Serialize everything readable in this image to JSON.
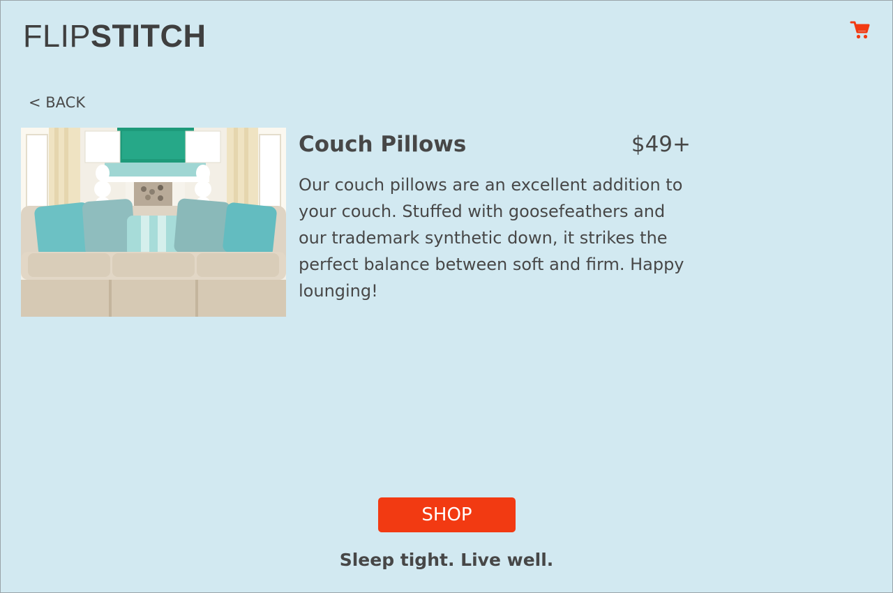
{
  "header": {
    "logo_light": "FLIP",
    "logo_bold": "STITCH",
    "cart_icon": "shopping-cart-icon",
    "cart_color": "#f23a12"
  },
  "nav": {
    "back_label": "< BACK"
  },
  "product": {
    "title": "Couch Pillows",
    "price": "$49+",
    "description": "Our couch pillows are an excellent addition to your couch. Stuffed with goosefeathers and our trademark synthetic down, it strikes the perfect balance between soft and firm. Happy lounging!",
    "image_subject": "living-room-sofa-with-pillows"
  },
  "actions": {
    "shop_label": "SHOP",
    "shop_color": "#f23a12"
  },
  "footer": {
    "tagline": "Sleep tight. Live well."
  },
  "colors": {
    "background": "#d2e9f1",
    "text": "#474747",
    "accent": "#f23a12"
  }
}
